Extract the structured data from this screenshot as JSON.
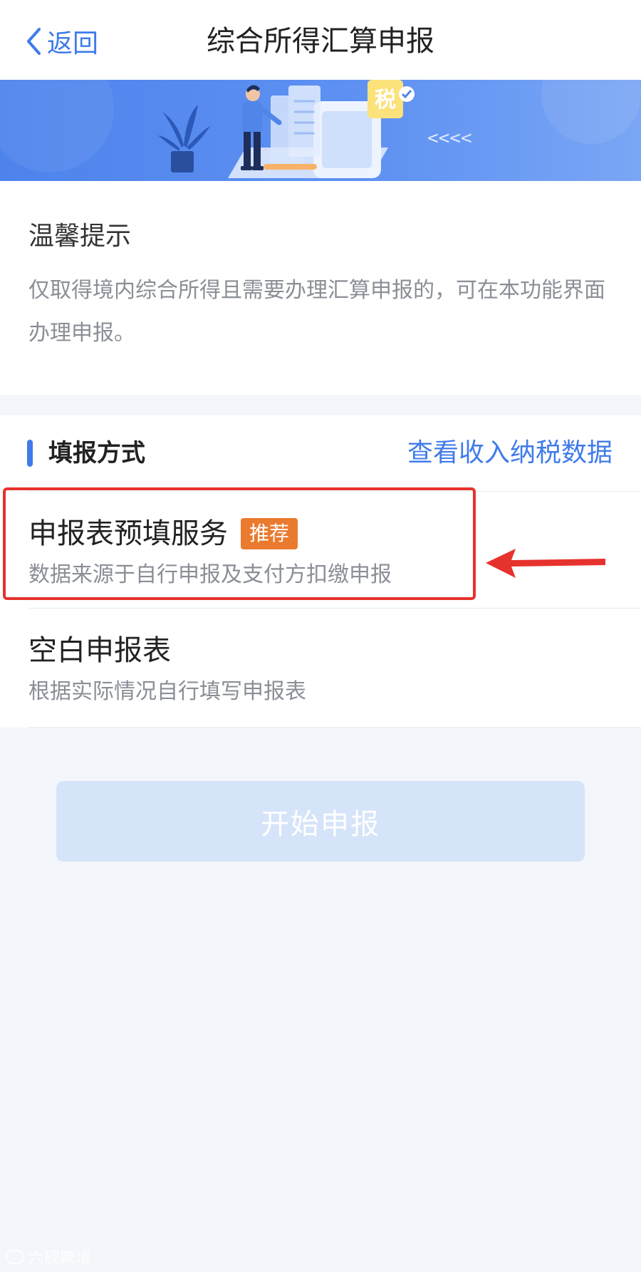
{
  "nav": {
    "back_label": "返回",
    "title": "综合所得汇算申报"
  },
  "banner": {
    "tax_char": "税",
    "arrows": "<<<<"
  },
  "tips": {
    "title": "温馨提示",
    "text": "仅取得境内综合所得且需要办理汇算申报的，可在本功能界面办理申报。"
  },
  "method": {
    "title": "填报方式",
    "link": "查看收入纳税数据",
    "options": [
      {
        "title": "申报表预填服务",
        "badge": "推荐",
        "desc": "数据来源于自行申报及支付方扣缴申报"
      },
      {
        "title": "空白申报表",
        "desc": "根据实际情况自行填写申报表"
      }
    ]
  },
  "start_button": "开始申报",
  "watermark": "六砚跨境",
  "colors": {
    "accent": "#3f7bea",
    "badge": "#ea7a2e",
    "highlight": "#e6322d",
    "button_disabled": "#d6e4f9"
  }
}
